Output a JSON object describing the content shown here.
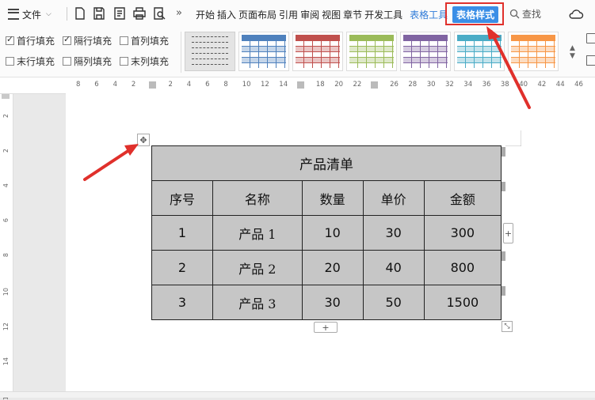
{
  "toolbar": {
    "menu_label": "文件",
    "more_label": "»",
    "tabs": [
      "开始",
      "插入",
      "页面布局",
      "引用",
      "审阅",
      "视图",
      "章节",
      "开发工具"
    ],
    "context_tab": "表格工具",
    "active_tab": "表格样式",
    "search_label": "查找"
  },
  "ribbon": {
    "options": [
      {
        "label": "首行填充",
        "checked": true
      },
      {
        "label": "隔行填充",
        "checked": true
      },
      {
        "label": "首列填充",
        "checked": false
      },
      {
        "label": "末行填充",
        "checked": false
      },
      {
        "label": "隔列填充",
        "checked": false
      },
      {
        "label": "末列填充",
        "checked": false
      }
    ],
    "style_colors": [
      "#e4e4e4",
      "#4f81bd",
      "#c0504d",
      "#9bbb59",
      "#8064a2",
      "#4bacc6",
      "#f79646"
    ]
  },
  "ruler": {
    "ticks": [
      "8",
      "6",
      "4",
      "2",
      "",
      "2",
      "4",
      "6",
      "8",
      "10",
      "12",
      "14",
      "",
      "18",
      "20",
      "22",
      "",
      "26",
      "28",
      "30",
      "32",
      "34",
      "36",
      "38",
      "40",
      "42",
      "44",
      "46"
    ],
    "vticks": [
      "2",
      "2",
      "4",
      "6",
      "8",
      "10",
      "12",
      "14",
      "16"
    ]
  },
  "table": {
    "title": "产品清单",
    "headers": [
      "序号",
      "名称",
      "数量",
      "单价",
      "金额"
    ],
    "rows": [
      [
        "1",
        "产品 1",
        "10",
        "30",
        "300"
      ],
      [
        "2",
        "产品 2",
        "20",
        "40",
        "800"
      ],
      [
        "3",
        "产品 3",
        "30",
        "50",
        "1500"
      ]
    ]
  },
  "controls": {
    "move_handle": "✥",
    "add_column": "+",
    "add_row": "+",
    "resize": "⤡"
  },
  "colors": {
    "accent": "#3a8ee6",
    "highlight": "#e0302b",
    "table_fill": "#c6c6c6"
  }
}
